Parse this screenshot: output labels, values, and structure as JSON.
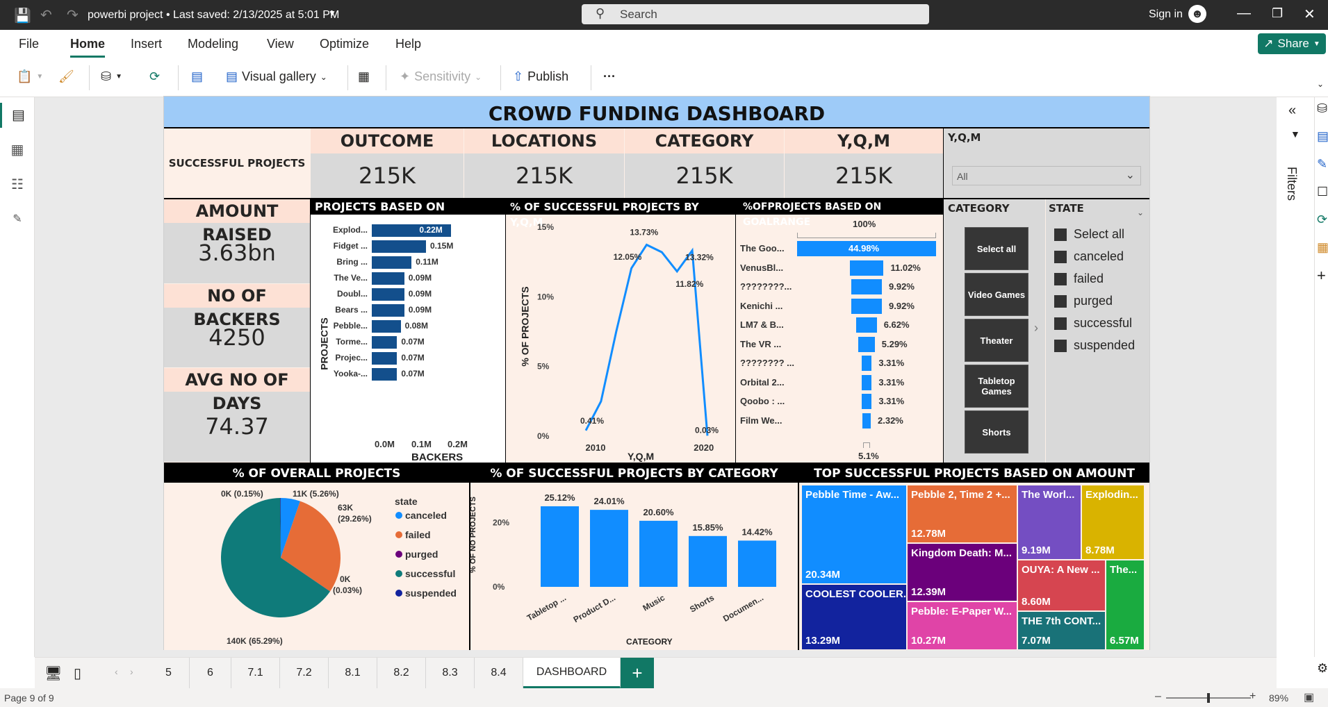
{
  "window": {
    "title": "powerbi project • Last saved: 2/13/2025 at 5:01 PM",
    "search_placeholder": "Search",
    "sign_in": "Sign in"
  },
  "menu": {
    "items": [
      "File",
      "Home",
      "Insert",
      "Modeling",
      "View",
      "Optimize",
      "Help"
    ],
    "share": "Share"
  },
  "ribbon": {
    "visual_gallery": "Visual gallery",
    "sensitivity": "Sensitivity",
    "publish": "Publish",
    "more": "···"
  },
  "right_pane": {
    "filters": "Filters"
  },
  "dashboard": {
    "title": "CROWD FUNDING DASHBOARD",
    "successful_projects": "SUCCESSFUL PROJECTS",
    "kpis": [
      {
        "label": "OUTCOME",
        "value": "215K"
      },
      {
        "label": "LOCATIONS",
        "value": "215K"
      },
      {
        "label": "CATEGORY",
        "value": "215K"
      },
      {
        "label": "Y,Q,M",
        "value": "215K"
      }
    ],
    "side_kpis": [
      {
        "label": "AMOUNT RAISED",
        "value": "3.63bn"
      },
      {
        "label": "NO OF BACKERS",
        "value": "4250"
      },
      {
        "label": "AVG NO OF DAYS",
        "value": "74.37"
      }
    ],
    "yqm_slicer": {
      "title": "Y,Q,M",
      "value": "All"
    },
    "category_slicer": {
      "title": "CATEGORY",
      "buttons": [
        "Select all",
        "Video Games",
        "Theater",
        "Tabletop Games",
        "Shorts"
      ]
    },
    "state_slicer": {
      "title": "STATE",
      "items": [
        "Select all",
        "canceled",
        "failed",
        "purged",
        "successful",
        "suspended"
      ]
    },
    "backers_chart": {
      "title": "PROJECTS BASED ON BACKERS",
      "ylabel": "PROJECTS",
      "xlabel": "BACKERS",
      "xticks": [
        "0.0M",
        "0.1M",
        "0.2M"
      ],
      "categories": [
        "Explod...",
        "Fidget ...",
        "Bring ...",
        "The Ve...",
        "Doubl...",
        "Bears ...",
        "Pebble...",
        "Torme...",
        "Projec...",
        "Yooka-..."
      ],
      "values": [
        0.22,
        0.15,
        0.11,
        0.09,
        0.09,
        0.09,
        0.08,
        0.07,
        0.07,
        0.07
      ],
      "labels": [
        "0.22M",
        "0.15M",
        "0.11M",
        "0.09M",
        "0.09M",
        "0.09M",
        "0.08M",
        "0.07M",
        "0.07M",
        "0.07M"
      ]
    },
    "yqm_line": {
      "title": "% OF SUCCESSFUL PROJECTS BY Y,Q,M",
      "ylabel": "% OF PROJECTS",
      "xlabel": "Y,Q,M",
      "yticks": [
        "15%",
        "10%",
        "5%",
        "0%"
      ],
      "xticks": [
        "2010",
        "2020"
      ],
      "x": [
        2009,
        2010,
        2011,
        2012,
        2013,
        2014,
        2015,
        2016,
        2017
      ],
      "y": [
        0.41,
        2.5,
        7.5,
        12.05,
        13.73,
        13.2,
        11.82,
        13.32,
        0.03
      ],
      "labels": [
        {
          "i": 0,
          "t": "0.41%"
        },
        {
          "i": 3,
          "t": "12.05%"
        },
        {
          "i": 4,
          "t": "13.73%"
        },
        {
          "i": 6,
          "t": "11.82%"
        },
        {
          "i": 7,
          "t": "13.32%"
        },
        {
          "i": 8,
          "t": "0.03%"
        }
      ]
    },
    "goal_chart": {
      "title": "%OFPROJECTS BASED ON GOALRANGE",
      "top": "100%",
      "bottom": "5.1%",
      "categories": [
        "The Goo...",
        "VenusBl...",
        "????????...",
        "Kenichi ...",
        "LM7 & B...",
        "The VR ...",
        "???????? ...",
        "Orbital 2...",
        "Qoobo : ...",
        "Film We..."
      ],
      "values": [
        44.98,
        11.02,
        9.92,
        9.92,
        6.62,
        5.29,
        3.31,
        3.31,
        3.31,
        2.32
      ],
      "labels": [
        "44.98%",
        "11.02%",
        "9.92%",
        "9.92%",
        "6.62%",
        "5.29%",
        "3.31%",
        "3.31%",
        "3.31%",
        "2.32%"
      ]
    },
    "pie": {
      "title": "% OF OVERALL PROJECTS",
      "legend_title": "state",
      "legend": [
        "canceled",
        "failed",
        "purged",
        "successful",
        "suspended"
      ],
      "values": [
        5.26,
        29.26,
        0.03,
        65.29,
        0.15
      ],
      "colors": [
        "#118dff",
        "#e66c37",
        "#6b007b",
        "#0f7b7a",
        "#12239e"
      ],
      "labels": [
        "11K (5.26%)",
        "63K (29.26%)",
        "0K (0.03%)",
        "140K (65.29%)",
        "0K (0.15%)"
      ]
    },
    "cat_bar": {
      "title": "% OF SUCCESSFUL PROJECTS BY CATEGORY",
      "ylabel": "% OF NO PROJECTS",
      "xlabel": "CATEGORY",
      "yticks": [
        "20%",
        "0%"
      ],
      "categories": [
        "Tabletop ...",
        "Product D...",
        "Music",
        "Shorts",
        "Documen..."
      ],
      "values": [
        25.12,
        24.01,
        20.6,
        15.85,
        14.42
      ],
      "labels": [
        "25.12%",
        "24.01%",
        "20.60%",
        "15.85%",
        "14.42%"
      ]
    },
    "treemap": {
      "title": "TOP SUCCESSFUL PROJECTS BASED ON AMOUNT RAISED",
      "items": [
        {
          "name": "Pebble Time - Aw...",
          "value": "20.34M",
          "color": "#118dff"
        },
        {
          "name": "COOLEST COOLER...",
          "value": "13.29M",
          "color": "#12239e"
        },
        {
          "name": "Pebble 2, Time 2 +...",
          "value": "12.78M",
          "color": "#e66c37"
        },
        {
          "name": "Kingdom Death: M...",
          "value": "12.39M",
          "color": "#6b007b"
        },
        {
          "name": "Pebble: E-Paper W...",
          "value": "10.27M",
          "color": "#e044a7"
        },
        {
          "name": "The Worl...",
          "value": "9.19M",
          "color": "#744ec2"
        },
        {
          "name": "Explodin...",
          "value": "8.78M",
          "color": "#d9b300"
        },
        {
          "name": "OUYA: A New ...",
          "value": "8.60M",
          "color": "#d64550"
        },
        {
          "name": "THE 7th CONT...",
          "value": "7.07M",
          "color": "#197278"
        },
        {
          "name": "The...",
          "value": "6.57M",
          "color": "#1aab40"
        }
      ]
    }
  },
  "tabs": [
    "5",
    "6",
    "7.1",
    "7.2",
    "8.1",
    "8.2",
    "8.3",
    "8.4",
    "DASHBOARD"
  ],
  "status": {
    "page": "Page 9 of 9",
    "zoom": "89%"
  }
}
